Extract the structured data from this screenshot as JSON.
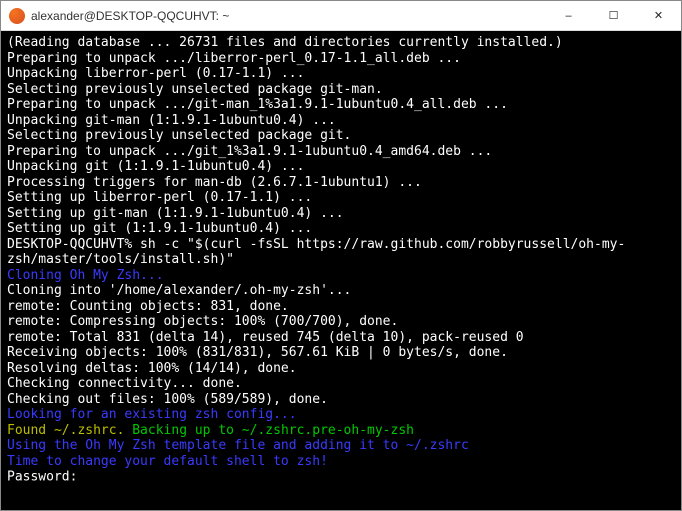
{
  "window": {
    "title": "alexander@DESKTOP-QQCUHVT: ~"
  },
  "controls": {
    "min_icon": "–",
    "max_icon": "☐",
    "close_icon": "✕"
  },
  "terminal": {
    "lines": [
      {
        "parts": [
          {
            "c": "c-white",
            "t": "(Reading database ... 26731 files and directories currently installed.)"
          }
        ]
      },
      {
        "parts": [
          {
            "c": "c-white",
            "t": "Preparing to unpack .../liberror-perl_0.17-1.1_all.deb ..."
          }
        ]
      },
      {
        "parts": [
          {
            "c": "c-white",
            "t": "Unpacking liberror-perl (0.17-1.1) ..."
          }
        ]
      },
      {
        "parts": [
          {
            "c": "c-white",
            "t": "Selecting previously unselected package git-man."
          }
        ]
      },
      {
        "parts": [
          {
            "c": "c-white",
            "t": "Preparing to unpack .../git-man_1%3a1.9.1-1ubuntu0.4_all.deb ..."
          }
        ]
      },
      {
        "parts": [
          {
            "c": "c-white",
            "t": "Unpacking git-man (1:1.9.1-1ubuntu0.4) ..."
          }
        ]
      },
      {
        "parts": [
          {
            "c": "c-white",
            "t": "Selecting previously unselected package git."
          }
        ]
      },
      {
        "parts": [
          {
            "c": "c-white",
            "t": "Preparing to unpack .../git_1%3a1.9.1-1ubuntu0.4_amd64.deb ..."
          }
        ]
      },
      {
        "parts": [
          {
            "c": "c-white",
            "t": "Unpacking git (1:1.9.1-1ubuntu0.4) ..."
          }
        ]
      },
      {
        "parts": [
          {
            "c": "c-white",
            "t": "Processing triggers for man-db (2.6.7.1-1ubuntu1) ..."
          }
        ]
      },
      {
        "parts": [
          {
            "c": "c-white",
            "t": "Setting up liberror-perl (0.17-1.1) ..."
          }
        ]
      },
      {
        "parts": [
          {
            "c": "c-white",
            "t": "Setting up git-man (1:1.9.1-1ubuntu0.4) ..."
          }
        ]
      },
      {
        "parts": [
          {
            "c": "c-white",
            "t": "Setting up git (1:1.9.1-1ubuntu0.4) ..."
          }
        ]
      },
      {
        "parts": [
          {
            "c": "c-white",
            "t": "DESKTOP-QQCUHVT% sh -c \"$(curl -fsSL https://raw.github.com/robbyrussell/oh-my-zsh/master/tools/install.sh)\""
          }
        ]
      },
      {
        "parts": [
          {
            "c": "c-blue",
            "t": "Cloning Oh My Zsh..."
          }
        ]
      },
      {
        "parts": [
          {
            "c": "c-white",
            "t": "Cloning into '/home/alexander/.oh-my-zsh'..."
          }
        ]
      },
      {
        "parts": [
          {
            "c": "c-white",
            "t": "remote: Counting objects: 831, done."
          }
        ]
      },
      {
        "parts": [
          {
            "c": "c-white",
            "t": "remote: Compressing objects: 100% (700/700), done."
          }
        ]
      },
      {
        "parts": [
          {
            "c": "c-white",
            "t": "remote: Total 831 (delta 14), reused 745 (delta 10), pack-reused 0"
          }
        ]
      },
      {
        "parts": [
          {
            "c": "c-white",
            "t": "Receiving objects: 100% (831/831), 567.61 KiB | 0 bytes/s, done."
          }
        ]
      },
      {
        "parts": [
          {
            "c": "c-white",
            "t": "Resolving deltas: 100% (14/14), done."
          }
        ]
      },
      {
        "parts": [
          {
            "c": "c-white",
            "t": "Checking connectivity... done."
          }
        ]
      },
      {
        "parts": [
          {
            "c": "c-white",
            "t": "Checking out files: 100% (589/589), done."
          }
        ]
      },
      {
        "parts": [
          {
            "c": "c-blue",
            "t": "Looking for an existing zsh config..."
          }
        ]
      },
      {
        "parts": [
          {
            "c": "c-yellow",
            "t": "Found ~/.zshrc."
          },
          {
            "c": "c-green",
            "t": " Backing up to ~/.zshrc.pre-oh-my-zsh"
          }
        ]
      },
      {
        "parts": [
          {
            "c": "c-blue",
            "t": "Using the Oh My Zsh template file and adding it to ~/.zshrc"
          }
        ]
      },
      {
        "parts": [
          {
            "c": "c-blue",
            "t": "Time to change your default shell to zsh!"
          }
        ]
      },
      {
        "parts": [
          {
            "c": "c-white",
            "t": "Password:"
          }
        ],
        "cursor": true
      }
    ]
  }
}
